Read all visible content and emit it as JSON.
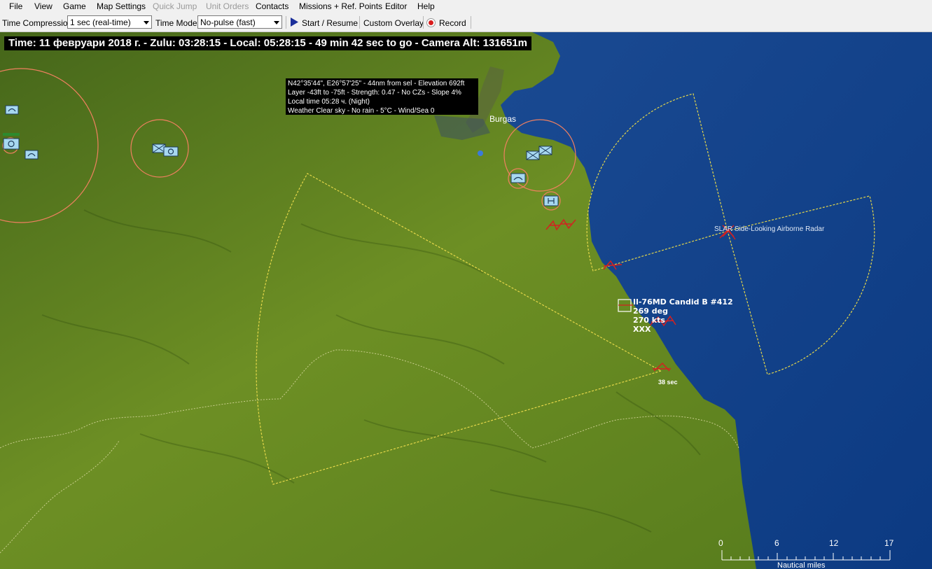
{
  "menu": {
    "items": [
      {
        "label": "File",
        "enabled": true
      },
      {
        "label": "View",
        "enabled": true
      },
      {
        "label": "Game",
        "enabled": true
      },
      {
        "label": "Map Settings",
        "enabled": true
      },
      {
        "label": "Quick Jump",
        "enabled": false
      },
      {
        "label": "Unit Orders",
        "enabled": false
      },
      {
        "label": "Contacts",
        "enabled": true
      },
      {
        "label": "Missions + Ref. Points",
        "enabled": true
      },
      {
        "label": "Editor",
        "enabled": true
      },
      {
        "label": "Help",
        "enabled": true
      }
    ]
  },
  "toolbar": {
    "time_compression_label": "Time Compression:",
    "time_compression_value": "1 sec (real-time)",
    "time_mode_label": "Time Mode:",
    "time_mode_value": "No-pulse (fast)",
    "start_resume_label": "Start / Resume",
    "custom_overlay_label": "Custom Overlay",
    "record_label": "Record"
  },
  "status": {
    "text": "Time: 11 февруари 2018 г. - Zulu: 03:28:15 - Local: 05:28:15 - 49 min 42 sec to go -  Camera Alt: 131651m"
  },
  "info": {
    "line1": "N42°35'44\", E26°57'25\" - 44nm from sel - Elevation 692ft",
    "line2": "Layer -43ft to -75ft - Strength: 0.47 - No CZs - Slope 4%",
    "line3": "Local time 05:28 ч. (Night)",
    "line4": "Weather Clear sky - No rain - 5°C - Wind/Sea 0"
  },
  "map": {
    "city_label": "Burgas",
    "slar_label": "SLAR Side-Looking Airborne Radar",
    "contact": {
      "name": "Il-76MD Candid B #412",
      "heading": "269 deg",
      "speed": "270 kts",
      "altitude": "XXX"
    },
    "timer_label": "38 sec",
    "colors": {
      "land": "#5a7a1e",
      "sea": "#0e3d86",
      "arc": "#e6d84a",
      "hostile": "#d42020",
      "friendly": "#a7d8f0",
      "range_ring": "#f08060"
    }
  },
  "scale": {
    "ticks": [
      "0",
      "6",
      "12",
      "17"
    ],
    "unit_label": "Nautical miles"
  }
}
